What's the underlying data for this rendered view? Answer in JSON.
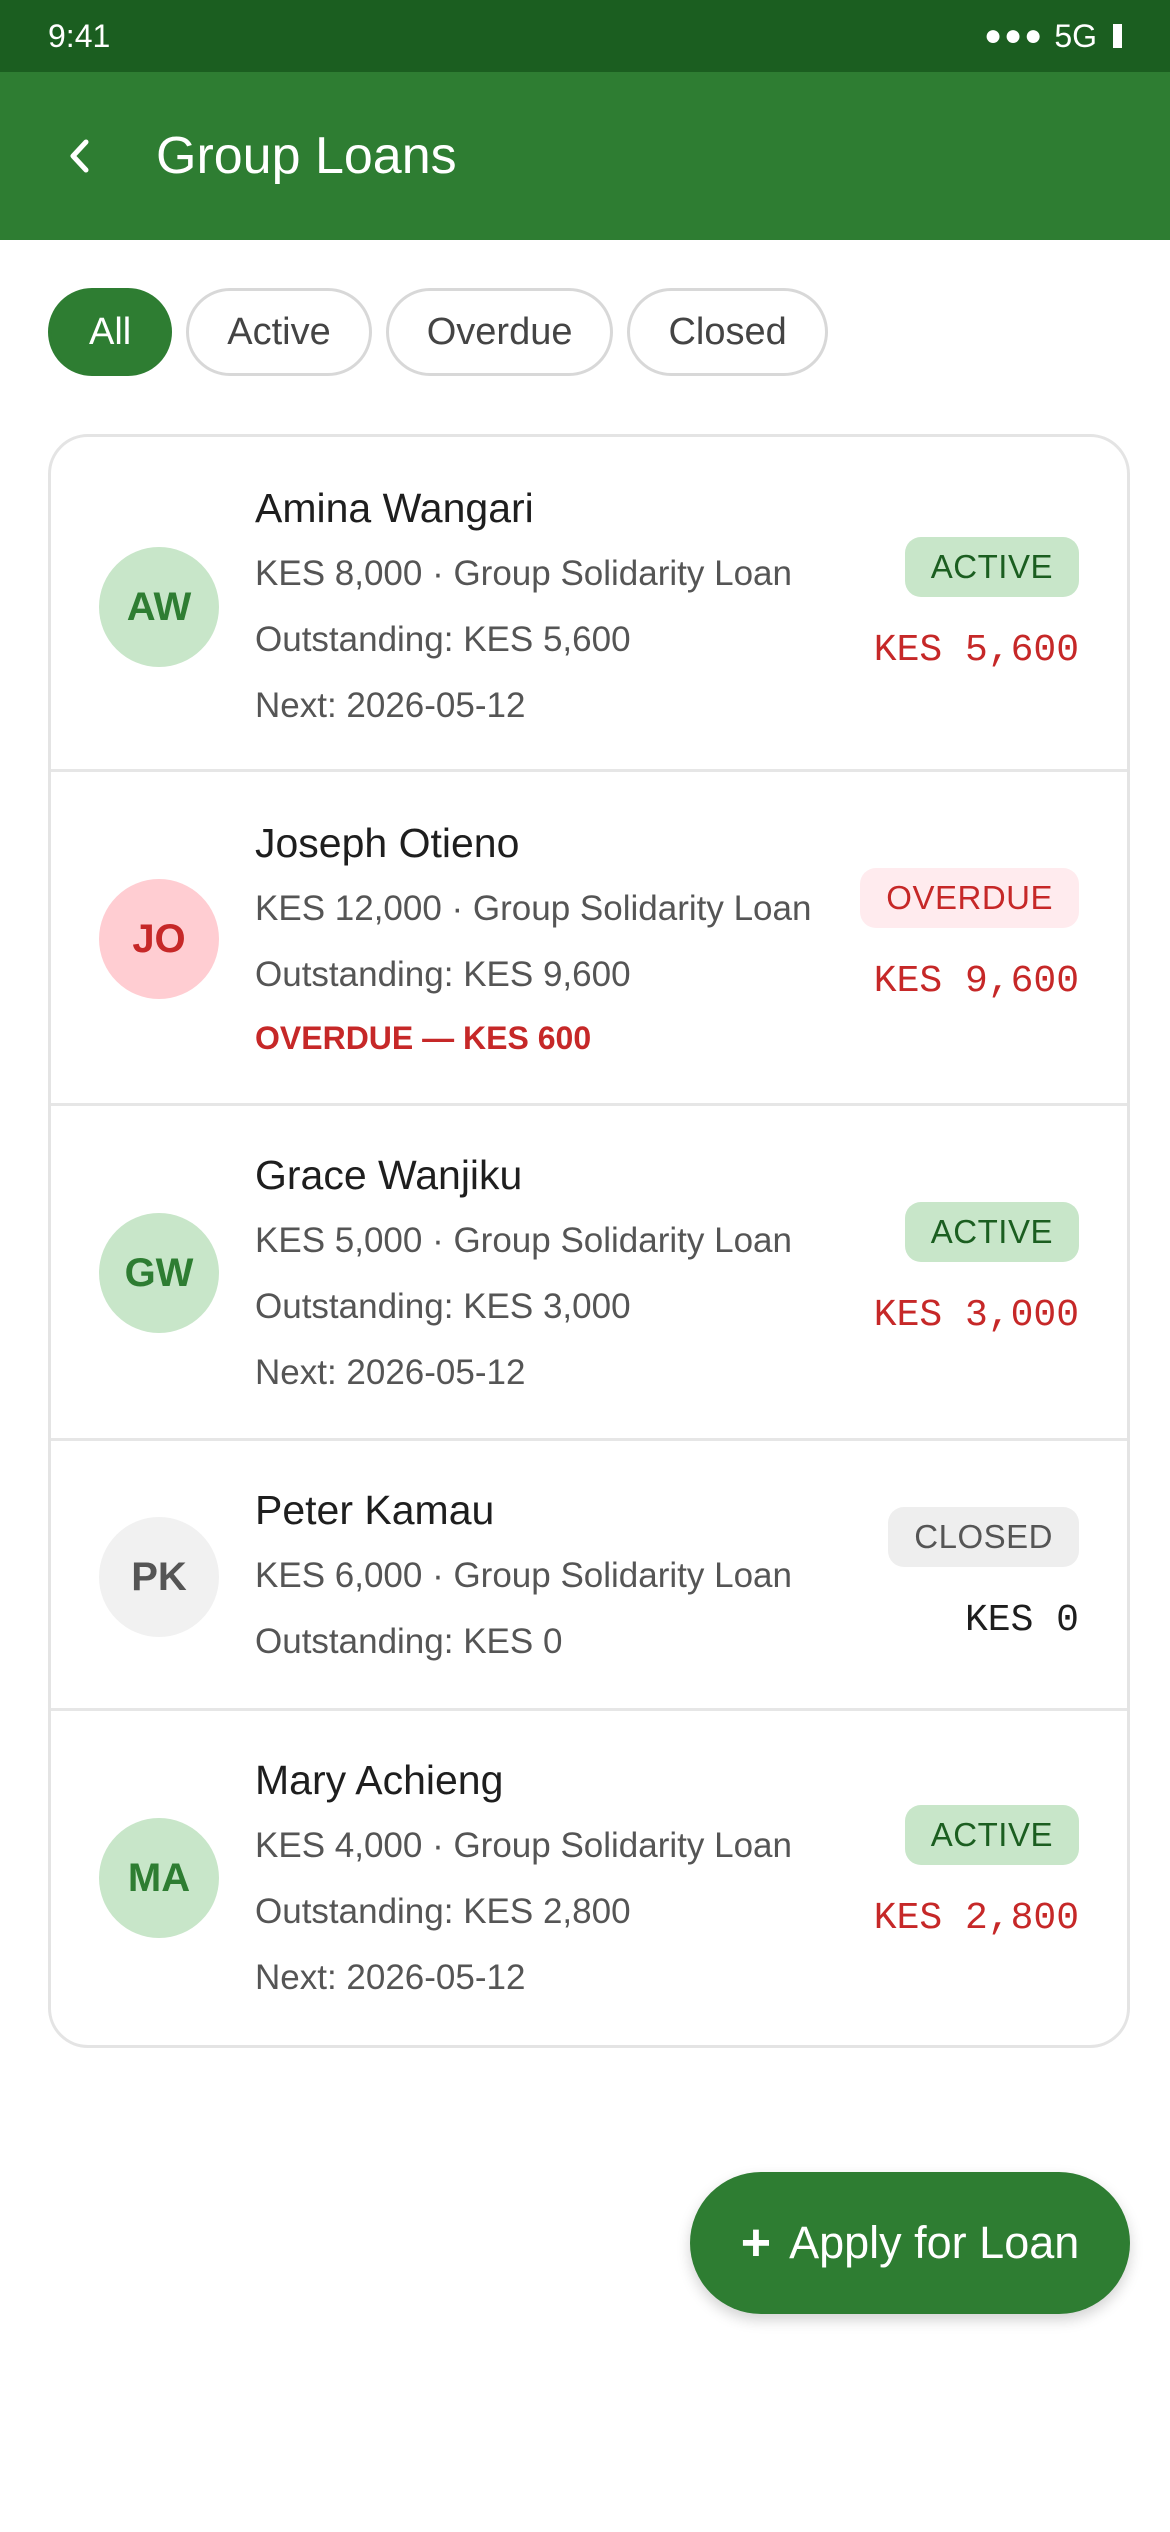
{
  "status_bar": {
    "time": "9:41",
    "signal": "●●●",
    "network": "5G"
  },
  "app_bar": {
    "back_icon": "chevron-left-icon",
    "title": "Group Loans"
  },
  "filters": [
    {
      "label": "All",
      "selected": true
    },
    {
      "label": "Active",
      "selected": false
    },
    {
      "label": "Overdue",
      "selected": false
    },
    {
      "label": "Closed",
      "selected": false
    }
  ],
  "loans": [
    {
      "initials": "AW",
      "name": "Amina Wangari",
      "summary": "KES 8,000 · Group Solidarity Loan",
      "outstanding": "Outstanding: KES 5,600",
      "next": "Next: 2026-05-12",
      "status": "ACTIVE",
      "amount": "KES 5,600"
    },
    {
      "initials": "JO",
      "name": "Joseph Otieno",
      "summary": "KES 12,000 · Group Solidarity Loan",
      "outstanding": "Outstanding: KES 9,600",
      "alert": "OVERDUE — KES 600",
      "status": "OVERDUE",
      "amount": "KES 9,600"
    },
    {
      "initials": "GW",
      "name": "Grace Wanjiku",
      "summary": "KES 5,000 · Group Solidarity Loan",
      "outstanding": "Outstanding: KES 3,000",
      "next": "Next: 2026-05-12",
      "status": "ACTIVE",
      "amount": "KES 3,000"
    },
    {
      "initials": "PK",
      "name": "Peter Kamau",
      "summary": "KES 6,000 · Group Solidarity Loan",
      "outstanding": "Outstanding: KES 0",
      "status": "CLOSED",
      "amount": "KES 0"
    },
    {
      "initials": "MA",
      "name": "Mary Achieng",
      "summary": "KES 4,000 · Group Solidarity Loan",
      "outstanding": "Outstanding: KES 2,800",
      "next": "Next: 2026-05-12",
      "status": "ACTIVE",
      "amount": "KES 2,800"
    }
  ],
  "fab": {
    "icon": "plus-icon",
    "label": "Apply for Loan"
  },
  "colors": {
    "status_bar": "#1b5e20",
    "primary": "#2e7d32",
    "active_bg": "#c8e6c9",
    "overdue": "#c62828",
    "overdue_bg": "#ffebee",
    "closed_bg": "#eeeeee"
  }
}
